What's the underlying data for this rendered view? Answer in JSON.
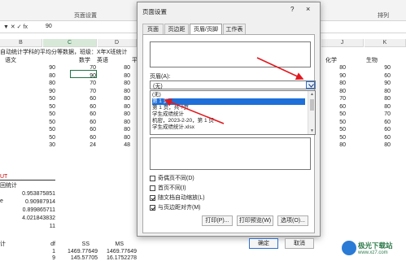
{
  "ribbon": {
    "page_setup": "页面设置",
    "arrange": "排列"
  },
  "formula": {
    "name_box": "",
    "value": "90"
  },
  "columns": [
    "B",
    "C",
    "D",
    "J",
    "K"
  ],
  "sheet": {
    "header_text": "自动统计学科的平均分等数据，班级：X年X班统计",
    "subjects_left": [
      "语文",
      "数学",
      "英语",
      "平"
    ],
    "subjects_right": [
      "化学",
      "生物"
    ],
    "rows": [
      [
        "90",
        "70",
        "80",
        "80",
        "90"
      ],
      [
        "80",
        "90",
        "80",
        "90",
        "60"
      ],
      [
        "80",
        "70",
        "80",
        "80",
        "90"
      ],
      [
        "90",
        "70",
        "80",
        "80",
        "80"
      ],
      [
        "50",
        "60",
        "80",
        "70",
        "80"
      ],
      [
        "50",
        "60",
        "80",
        "60",
        "80"
      ],
      [
        "50",
        "60",
        "80",
        "50",
        "70"
      ],
      [
        "50",
        "60",
        "80",
        "50",
        "60"
      ],
      [
        "50",
        "60",
        "80",
        "50",
        "60"
      ],
      [
        "50",
        "60",
        "80",
        "50",
        "60"
      ],
      [
        "30",
        "24",
        "48",
        "80",
        "80"
      ]
    ],
    "stats_label": "回统计",
    "stats": [
      "0.953875851",
      "0.90987914",
      "0.899865711",
      "4.021843832",
      "11"
    ],
    "side_labels": [
      "UT",
      "e"
    ],
    "anova_label": "计",
    "anova_headers": [
      "df",
      "SS",
      "MS"
    ],
    "anova_rows": [
      [
        "1",
        "1469.77649",
        "1469.77649"
      ],
      [
        "9",
        "145.57705",
        "16.1752278"
      ]
    ]
  },
  "dialog": {
    "title": "页面设置",
    "help": "?",
    "close": "×",
    "tabs": [
      "页面",
      "页边距",
      "页眉/页脚",
      "工作表"
    ],
    "active_tab": "页眉/页脚",
    "header_label": "页眉(A):",
    "header_value": "(无)",
    "options": [
      "(无)",
      "第 1 页",
      "第 1 页，共 ?页",
      "学生成绩统计",
      "机密，2023-2-20，第 1 页",
      "学生成绩统计.xlsx"
    ],
    "selected_option": "第 1 页",
    "checkboxes": [
      {
        "label": "奇偶页不同(D)",
        "checked": false
      },
      {
        "label": "首页不同(I)",
        "checked": false
      },
      {
        "label": "随文档自动缩放(L)",
        "checked": true
      },
      {
        "label": "与页边距对齐(M)",
        "checked": true
      }
    ],
    "print_btn": "打印(P)...",
    "preview_btn": "打印预览(W)",
    "options_btn": "选项(O)...",
    "ok_btn": "确定",
    "cancel_btn": "取消"
  },
  "watermark": {
    "title": "极光下载站",
    "url": "www.xz7.com"
  },
  "colors": {
    "accent": "#1e6fd9",
    "arrow": "#e0191f",
    "excel_green": "#217346"
  }
}
